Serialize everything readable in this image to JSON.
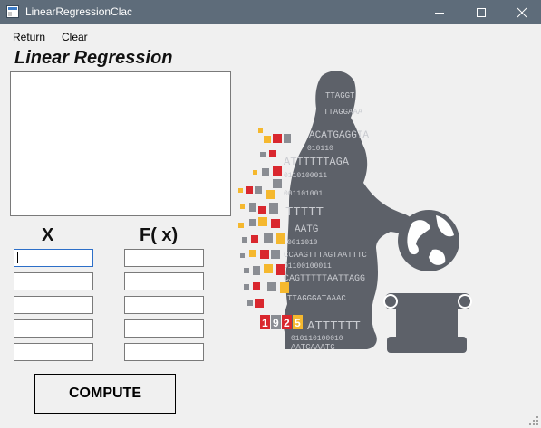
{
  "window": {
    "title": "LinearRegressionClac"
  },
  "menu": {
    "items": [
      "Return",
      "Clear"
    ]
  },
  "form": {
    "title": "Linear Regression",
    "x_header": "X",
    "fx_header": "F( x)",
    "compute_label": "COMPUTE",
    "x_values": [
      "",
      "",
      "",
      "",
      ""
    ],
    "fx_values": [
      "",
      "",
      "",
      "",
      ""
    ]
  },
  "illustration": {
    "year_digits": [
      "1",
      "9",
      "2",
      "5"
    ],
    "dna_text": [
      "TTAGGT",
      "TTAGGAAA",
      "ACATGAGGTA",
      "ATTTTTTAGA",
      "TTTTT",
      "AATG",
      "CCAAGTTTAGTAATTTC",
      "CAGTTTTTAATTAGG",
      "TTAGGGATAAAC",
      "ATTTTTT",
      "AATCAAATG"
    ],
    "binary_text": [
      "010110",
      "0110100011",
      "001101001",
      "0011010",
      "01100100011",
      "010110100010"
    ]
  },
  "colors": {
    "titlebar": "#5e6c7a",
    "silhouette": "#5d6169",
    "red": "#d9272e",
    "yellow": "#f5b82e",
    "grey": "#8a8d93"
  }
}
